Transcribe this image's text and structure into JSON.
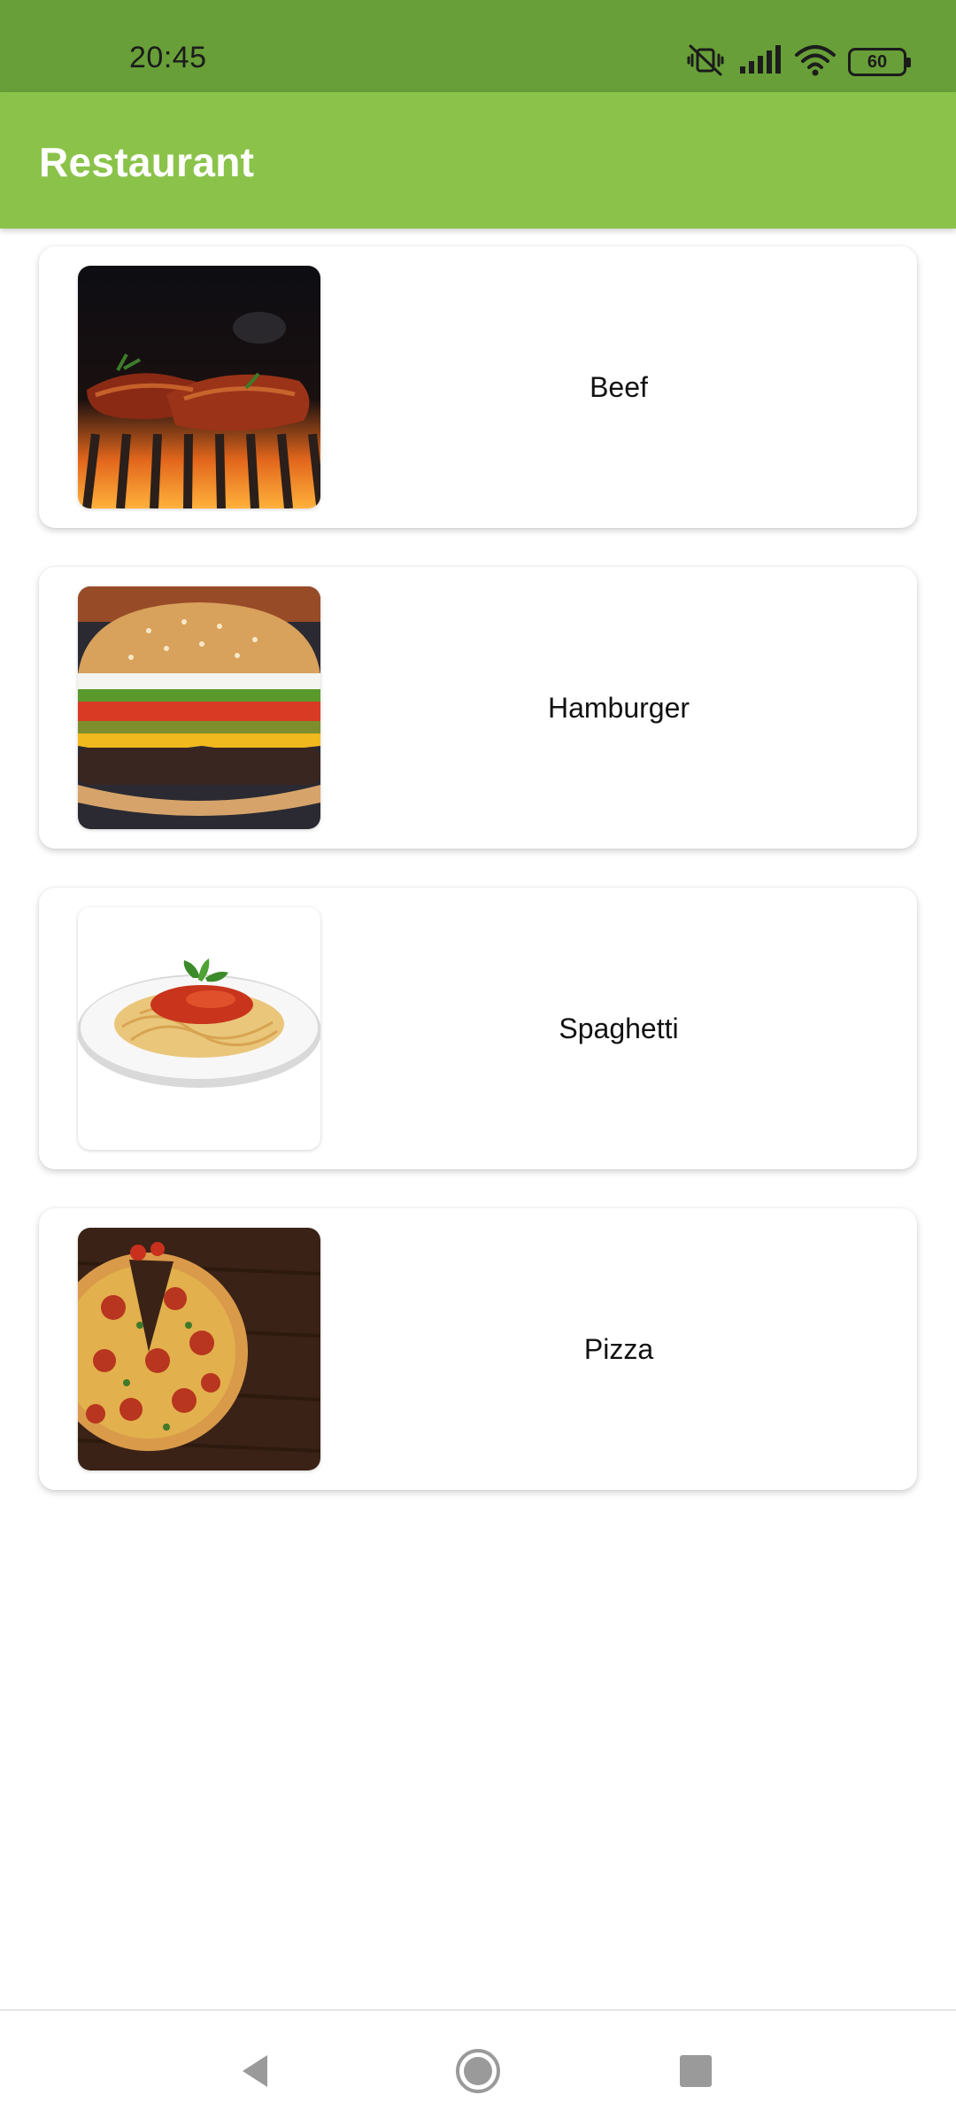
{
  "status_bar": {
    "time": "20:45",
    "battery_level": "60",
    "icons": [
      "mute-vibrate-icon",
      "signal-icon",
      "wifi-icon",
      "battery-icon"
    ]
  },
  "app_bar": {
    "title": "Restaurant"
  },
  "colors": {
    "status_bar": "#689f38",
    "app_bar": "#8bc34a",
    "card_background": "#ffffff",
    "text": "#111111"
  },
  "menu_items": [
    {
      "label": "Beef",
      "image": "beef-image"
    },
    {
      "label": "Hamburger",
      "image": "hamburger-image"
    },
    {
      "label": "Spaghetti",
      "image": "spaghetti-image"
    },
    {
      "label": "Pizza",
      "image": "pizza-image"
    }
  ],
  "nav_bar": {
    "buttons": [
      "back-icon",
      "home-icon",
      "recents-icon"
    ]
  }
}
